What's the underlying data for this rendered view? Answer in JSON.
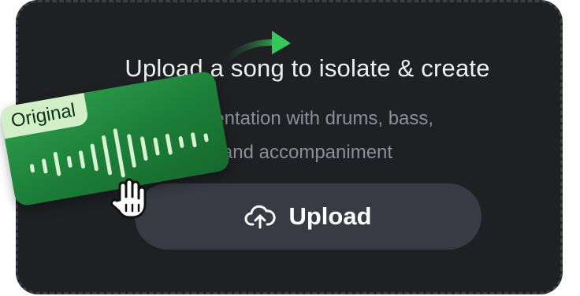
{
  "dropzone": {
    "title": "Upload a song to isolate & create",
    "subtitle_line1": "rumentation with drums, bass,",
    "subtitle_line2": "and accompaniment",
    "upload_button": {
      "label": "Upload",
      "icon": "cloud-upload-icon"
    }
  },
  "floating_card": {
    "badge_label": "Original",
    "waveform_icon": "waveform-icon",
    "cursor_icon": "hand-cursor-icon"
  },
  "colors": {
    "background": "#1f2024",
    "button": "#393b44",
    "accent_green": "#2ea24e",
    "badge_green": "#d2efc8",
    "subtitle_text": "#8d8f98"
  }
}
